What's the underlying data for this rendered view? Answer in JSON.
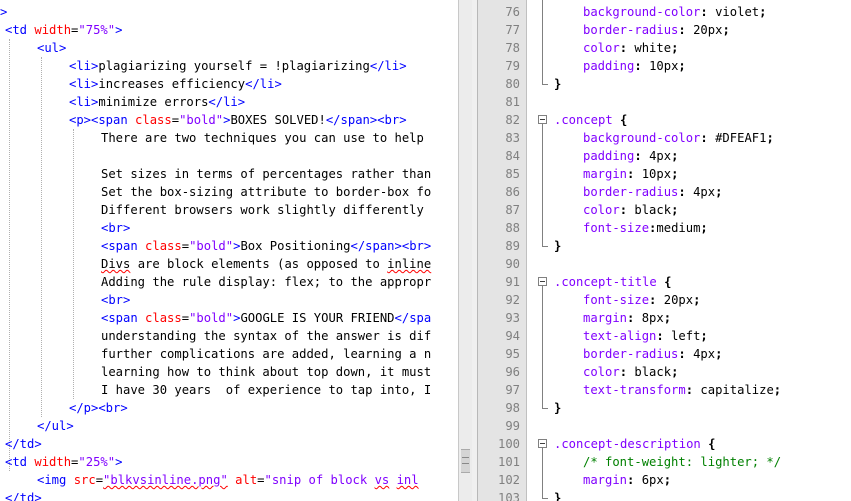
{
  "left_editor": {
    "lines": [
      {
        "indent": 0,
        "parts": [
          {
            "c": "tag",
            "t": ">"
          }
        ]
      },
      {
        "indent": 1,
        "parts": [
          {
            "c": "tag",
            "t": "<td "
          },
          {
            "c": "attr",
            "t": "width"
          },
          {
            "c": "txt",
            "t": "="
          },
          {
            "c": "val",
            "t": "\"75%\""
          },
          {
            "c": "tag",
            "t": ">"
          }
        ]
      },
      {
        "indent": 2,
        "parts": [
          {
            "c": "tag",
            "t": "<ul>"
          }
        ]
      },
      {
        "indent": 3,
        "parts": [
          {
            "c": "tag",
            "t": "<li>"
          },
          {
            "c": "txt",
            "t": "plagiarizing yourself = !plagiarizing"
          },
          {
            "c": "tag",
            "t": "</li>"
          }
        ]
      },
      {
        "indent": 3,
        "parts": [
          {
            "c": "tag",
            "t": "<li>"
          },
          {
            "c": "txt",
            "t": "increases efficiency"
          },
          {
            "c": "tag",
            "t": "</li>"
          }
        ]
      },
      {
        "indent": 3,
        "parts": [
          {
            "c": "tag",
            "t": "<li>"
          },
          {
            "c": "txt",
            "t": "minimize errors"
          },
          {
            "c": "tag",
            "t": "</li>"
          }
        ]
      },
      {
        "indent": 3,
        "parts": [
          {
            "c": "tag",
            "t": "<p><span "
          },
          {
            "c": "attr",
            "t": "class"
          },
          {
            "c": "txt",
            "t": "="
          },
          {
            "c": "val",
            "t": "\"bold\""
          },
          {
            "c": "tag",
            "t": ">"
          },
          {
            "c": "txt",
            "t": "BOXES SOLVED!"
          },
          {
            "c": "tag",
            "t": "</span><br>"
          }
        ]
      },
      {
        "indent": 4,
        "parts": [
          {
            "c": "txt",
            "t": "There are two techniques you can use to help"
          }
        ]
      },
      {
        "indent": 4,
        "parts": []
      },
      {
        "indent": 4,
        "parts": [
          {
            "c": "txt",
            "t": "Set sizes in terms of percentages rather than"
          }
        ]
      },
      {
        "indent": 4,
        "parts": [
          {
            "c": "txt",
            "t": "Set the box-sizing attribute to border-box fo"
          }
        ]
      },
      {
        "indent": 4,
        "parts": [
          {
            "c": "txt",
            "t": "Different browsers work slightly differently"
          }
        ]
      },
      {
        "indent": 4,
        "parts": [
          {
            "c": "tag",
            "t": "<br>"
          }
        ]
      },
      {
        "indent": 4,
        "parts": [
          {
            "c": "tag",
            "t": "<span "
          },
          {
            "c": "attr",
            "t": "class"
          },
          {
            "c": "txt",
            "t": "="
          },
          {
            "c": "val",
            "t": "\"bold\""
          },
          {
            "c": "tag",
            "t": ">"
          },
          {
            "c": "txt",
            "t": "Box Positioning"
          },
          {
            "c": "tag",
            "t": "</span><br>"
          }
        ]
      },
      {
        "indent": 4,
        "parts": [
          {
            "c": "txt squig",
            "t": "Divs"
          },
          {
            "c": "txt",
            "t": " are block elements (as opposed to "
          },
          {
            "c": "txt squig",
            "t": "inline"
          }
        ]
      },
      {
        "indent": 4,
        "parts": [
          {
            "c": "txt",
            "t": "Adding the rule display: flex; to the appropr"
          }
        ]
      },
      {
        "indent": 4,
        "parts": [
          {
            "c": "tag",
            "t": "<br>"
          }
        ]
      },
      {
        "indent": 4,
        "parts": [
          {
            "c": "tag",
            "t": "<span "
          },
          {
            "c": "attr",
            "t": "class"
          },
          {
            "c": "txt",
            "t": "="
          },
          {
            "c": "val",
            "t": "\"bold\""
          },
          {
            "c": "tag",
            "t": ">"
          },
          {
            "c": "txt",
            "t": "GOOGLE IS YOUR FRIEND"
          },
          {
            "c": "tag",
            "t": "</spa"
          }
        ]
      },
      {
        "indent": 4,
        "parts": [
          {
            "c": "txt",
            "t": "understanding the syntax of the answer is dif"
          }
        ]
      },
      {
        "indent": 4,
        "parts": [
          {
            "c": "txt",
            "t": "further complications are added, learning a n"
          }
        ]
      },
      {
        "indent": 4,
        "parts": [
          {
            "c": "txt",
            "t": "learning how to think about top down, it must"
          }
        ]
      },
      {
        "indent": 4,
        "parts": [
          {
            "c": "txt",
            "t": "I have 30 years  of experience to tap into, I"
          }
        ]
      },
      {
        "indent": 3,
        "parts": [
          {
            "c": "tag",
            "t": "</p><br>"
          }
        ]
      },
      {
        "indent": 2,
        "parts": [
          {
            "c": "tag",
            "t": "</ul>"
          }
        ]
      },
      {
        "indent": 1,
        "parts": [
          {
            "c": "tag",
            "t": "</td>"
          }
        ]
      },
      {
        "indent": 1,
        "parts": [
          {
            "c": "tag",
            "t": "<td "
          },
          {
            "c": "attr",
            "t": "width"
          },
          {
            "c": "txt",
            "t": "="
          },
          {
            "c": "val",
            "t": "\"25%\""
          },
          {
            "c": "tag",
            "t": ">"
          }
        ]
      },
      {
        "indent": 2,
        "parts": [
          {
            "c": "tag",
            "t": "<img "
          },
          {
            "c": "attr",
            "t": "src"
          },
          {
            "c": "txt",
            "t": "="
          },
          {
            "c": "val squig",
            "t": "\"blkvsinline.png\""
          },
          {
            "c": "txt",
            "t": " "
          },
          {
            "c": "attr",
            "t": "alt"
          },
          {
            "c": "txt",
            "t": "="
          },
          {
            "c": "val",
            "t": "\"snip of block "
          },
          {
            "c": "val squig",
            "t": "vs"
          },
          {
            "c": "val",
            "t": " "
          },
          {
            "c": "val squig",
            "t": "inl"
          }
        ]
      },
      {
        "indent": 1,
        "parts": [
          {
            "c": "tag",
            "t": "</td>"
          }
        ]
      }
    ]
  },
  "right_editor": {
    "lines": [
      {
        "n": "76",
        "ind": 1,
        "parts": [
          {
            "c": "prop",
            "t": "background-color"
          },
          {
            "c": "punc",
            "t": ": "
          },
          {
            "c": "pval",
            "t": "violet"
          },
          {
            "c": "punc",
            "t": ";"
          }
        ]
      },
      {
        "n": "77",
        "ind": 1,
        "parts": [
          {
            "c": "prop",
            "t": "border-radius"
          },
          {
            "c": "punc",
            "t": ": "
          },
          {
            "c": "pval",
            "t": "20px"
          },
          {
            "c": "punc",
            "t": ";"
          }
        ]
      },
      {
        "n": "78",
        "ind": 1,
        "parts": [
          {
            "c": "prop",
            "t": "color"
          },
          {
            "c": "punc",
            "t": ": "
          },
          {
            "c": "pval",
            "t": "white"
          },
          {
            "c": "punc",
            "t": ";"
          }
        ]
      },
      {
        "n": "79",
        "ind": 1,
        "parts": [
          {
            "c": "prop",
            "t": "padding"
          },
          {
            "c": "punc",
            "t": ": "
          },
          {
            "c": "pval",
            "t": "10px"
          },
          {
            "c": "punc",
            "t": ";"
          }
        ]
      },
      {
        "n": "80",
        "ind": 0,
        "parts": [
          {
            "c": "brace",
            "t": "}"
          }
        ]
      },
      {
        "n": "81",
        "ind": 0,
        "parts": []
      },
      {
        "n": "82",
        "ind": 0,
        "parts": [
          {
            "c": "sel",
            "t": ".concept"
          },
          {
            "c": "txt",
            "t": " "
          },
          {
            "c": "brace",
            "t": "{"
          }
        ]
      },
      {
        "n": "83",
        "ind": 1,
        "parts": [
          {
            "c": "prop",
            "t": "background-color"
          },
          {
            "c": "punc",
            "t": ": "
          },
          {
            "c": "pval",
            "t": "#DFEAF1"
          },
          {
            "c": "punc",
            "t": ";"
          }
        ]
      },
      {
        "n": "84",
        "ind": 1,
        "parts": [
          {
            "c": "prop",
            "t": "padding"
          },
          {
            "c": "punc",
            "t": ": "
          },
          {
            "c": "pval",
            "t": "4px"
          },
          {
            "c": "punc",
            "t": ";"
          }
        ]
      },
      {
        "n": "85",
        "ind": 1,
        "parts": [
          {
            "c": "prop",
            "t": "margin"
          },
          {
            "c": "punc",
            "t": ": "
          },
          {
            "c": "pval",
            "t": "10px"
          },
          {
            "c": "punc",
            "t": ";"
          }
        ]
      },
      {
        "n": "86",
        "ind": 1,
        "parts": [
          {
            "c": "prop",
            "t": "border-radius"
          },
          {
            "c": "punc",
            "t": ": "
          },
          {
            "c": "pval",
            "t": "4px"
          },
          {
            "c": "punc",
            "t": ";"
          }
        ]
      },
      {
        "n": "87",
        "ind": 1,
        "parts": [
          {
            "c": "prop",
            "t": "color"
          },
          {
            "c": "punc",
            "t": ": "
          },
          {
            "c": "pval",
            "t": "black"
          },
          {
            "c": "punc",
            "t": ";"
          }
        ]
      },
      {
        "n": "88",
        "ind": 1,
        "parts": [
          {
            "c": "prop",
            "t": "font-size"
          },
          {
            "c": "punc",
            "t": ":"
          },
          {
            "c": "pval",
            "t": "medium"
          },
          {
            "c": "punc",
            "t": ";"
          }
        ]
      },
      {
        "n": "89",
        "ind": 0,
        "parts": [
          {
            "c": "brace",
            "t": "}"
          }
        ]
      },
      {
        "n": "90",
        "ind": 0,
        "parts": []
      },
      {
        "n": "91",
        "ind": 0,
        "parts": [
          {
            "c": "sel",
            "t": ".concept-title"
          },
          {
            "c": "txt",
            "t": " "
          },
          {
            "c": "brace",
            "t": "{"
          }
        ]
      },
      {
        "n": "92",
        "ind": 1,
        "parts": [
          {
            "c": "prop",
            "t": "font-size"
          },
          {
            "c": "punc",
            "t": ": "
          },
          {
            "c": "pval",
            "t": "20px"
          },
          {
            "c": "punc",
            "t": ";"
          }
        ]
      },
      {
        "n": "93",
        "ind": 1,
        "parts": [
          {
            "c": "prop",
            "t": "margin"
          },
          {
            "c": "punc",
            "t": ": "
          },
          {
            "c": "pval",
            "t": "8px"
          },
          {
            "c": "punc",
            "t": ";"
          }
        ]
      },
      {
        "n": "94",
        "ind": 1,
        "parts": [
          {
            "c": "prop",
            "t": "text-align"
          },
          {
            "c": "punc",
            "t": ": "
          },
          {
            "c": "pval",
            "t": "left"
          },
          {
            "c": "punc",
            "t": ";"
          }
        ]
      },
      {
        "n": "95",
        "ind": 1,
        "parts": [
          {
            "c": "prop",
            "t": "border-radius"
          },
          {
            "c": "punc",
            "t": ": "
          },
          {
            "c": "pval",
            "t": "4px"
          },
          {
            "c": "punc",
            "t": ";"
          }
        ]
      },
      {
        "n": "96",
        "ind": 1,
        "parts": [
          {
            "c": "prop",
            "t": "color"
          },
          {
            "c": "punc",
            "t": ": "
          },
          {
            "c": "pval",
            "t": "black"
          },
          {
            "c": "punc",
            "t": ";"
          }
        ]
      },
      {
        "n": "97",
        "ind": 1,
        "parts": [
          {
            "c": "prop",
            "t": "text-transform"
          },
          {
            "c": "punc",
            "t": ": "
          },
          {
            "c": "pval",
            "t": "capitalize"
          },
          {
            "c": "punc",
            "t": ";"
          }
        ]
      },
      {
        "n": "98",
        "ind": 0,
        "parts": [
          {
            "c": "brace",
            "t": "}"
          }
        ]
      },
      {
        "n": "99",
        "ind": 0,
        "parts": []
      },
      {
        "n": "100",
        "ind": 0,
        "parts": [
          {
            "c": "sel",
            "t": ".concept-description"
          },
          {
            "c": "txt",
            "t": " "
          },
          {
            "c": "brace",
            "t": "{"
          }
        ]
      },
      {
        "n": "101",
        "ind": 1,
        "parts": [
          {
            "c": "comment",
            "t": "/* font-weight: lighter; */"
          }
        ]
      },
      {
        "n": "102",
        "ind": 1,
        "parts": [
          {
            "c": "prop",
            "t": "margin"
          },
          {
            "c": "punc",
            "t": ": "
          },
          {
            "c": "pval",
            "t": "6px"
          },
          {
            "c": "punc",
            "t": ";"
          }
        ]
      },
      {
        "n": "103",
        "ind": 0,
        "parts": [
          {
            "c": "brace",
            "t": "}"
          }
        ]
      }
    ]
  }
}
